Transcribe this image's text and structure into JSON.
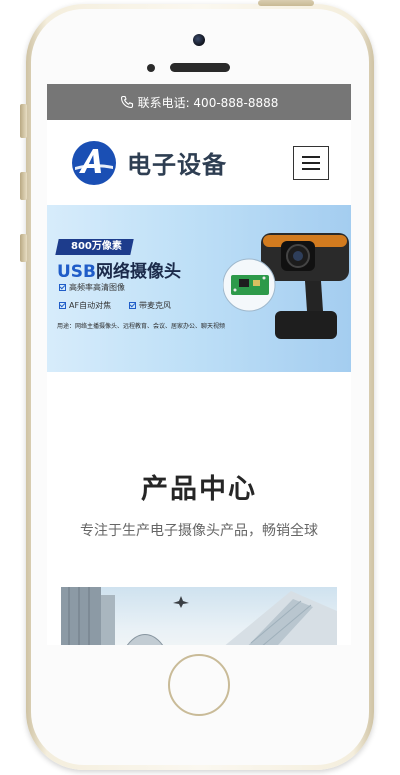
{
  "topbar": {
    "phone_icon": "phone-icon",
    "contact_text": "联系电话: 400-888-8888"
  },
  "header": {
    "logo_icon": "logo-a-icon",
    "logo_text": "电子设备",
    "menu_icon": "hamburger-menu-icon"
  },
  "banner": {
    "badge": "800万像素",
    "headline_usb": "USB",
    "headline_rest": "网络摄像头",
    "features": [
      "高频率高清图像",
      "AF自动对焦",
      "带麦克风"
    ],
    "usage": "用途：网络主播摄像头、远程教育、会议、居家办公、聊天视频"
  },
  "products": {
    "title": "产品中心",
    "subtitle": "专注于生产电子摄像头产品，畅销全球"
  },
  "colors": {
    "topbar_bg": "#767676",
    "logo_blue": "#1a4fb4",
    "logo_text": "#2e3e52",
    "banner_accent": "#1d3c8c",
    "camera_orange": "#f08a1d"
  }
}
